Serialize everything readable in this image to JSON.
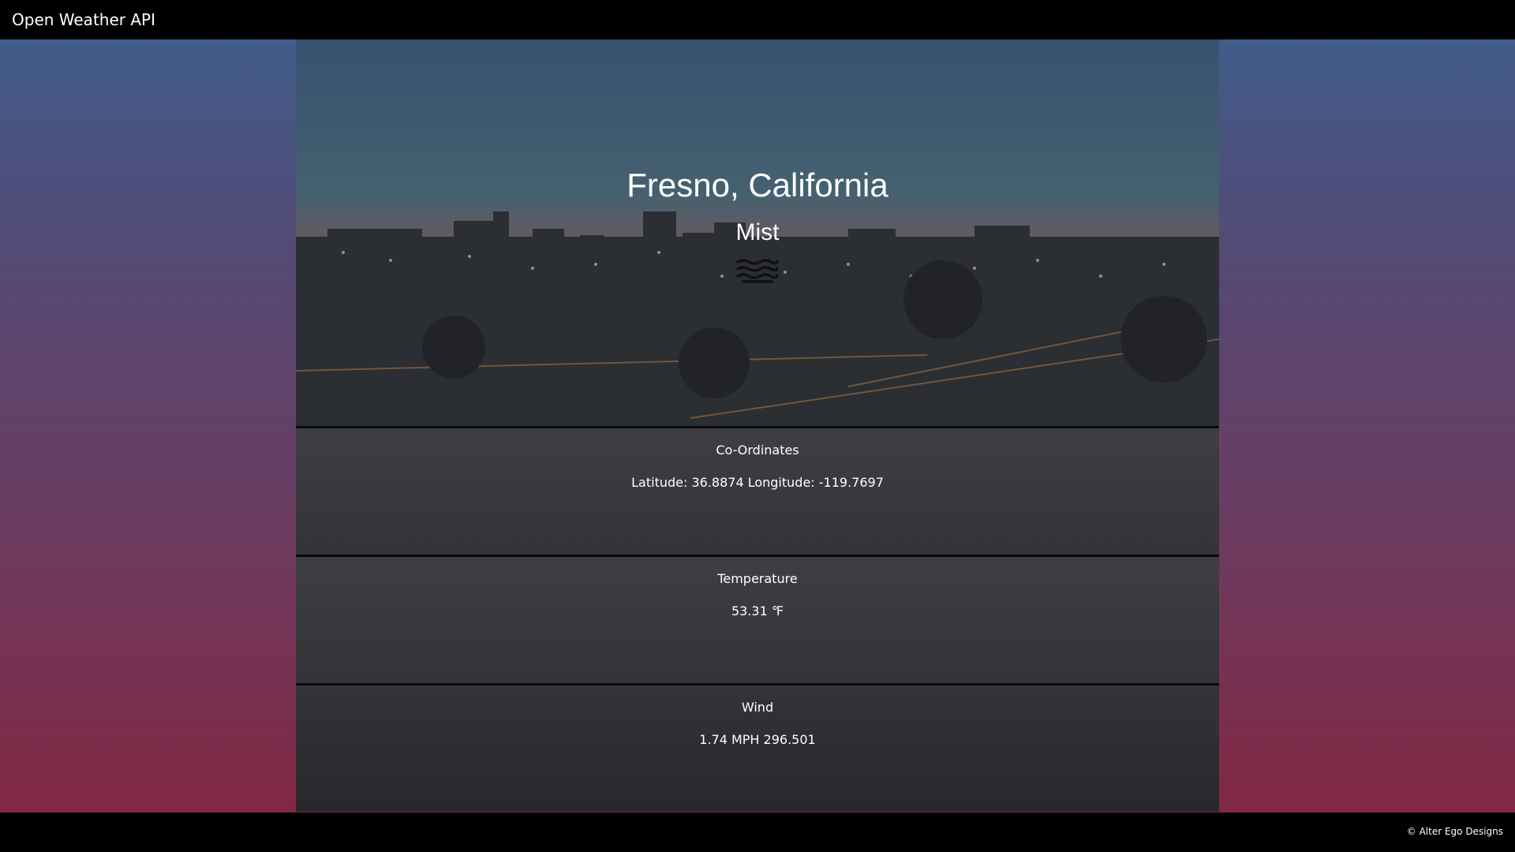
{
  "navbar": {
    "brand": "Open Weather API"
  },
  "weather": {
    "location": "Fresno, California",
    "condition": "Mist",
    "condition_icon": "mist-icon"
  },
  "sections": {
    "coordinates": {
      "title": "Co-Ordinates",
      "value": "Latitude: 36.8874 Longitude: -119.7697"
    },
    "temperature": {
      "title": "Temperature",
      "value": "53.31 ℉"
    },
    "wind": {
      "title": "Wind",
      "value": "1.74 MPH 296.501"
    }
  },
  "footer": {
    "copyright": "© Alter Ego Designs"
  },
  "colors": {
    "bar": "#000000",
    "gradient_top": "#3d5f8c",
    "gradient_bottom": "#85253f",
    "panel": "#333437"
  }
}
